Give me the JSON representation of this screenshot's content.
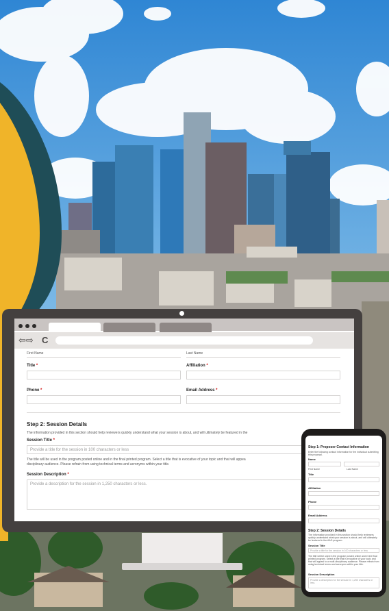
{
  "form": {
    "first_name_label": "First Name",
    "last_name_label": "Last Name",
    "title_label": "Title",
    "affiliation_label": "Affiliation",
    "phone_label": "Phone",
    "email_label": "Email Address",
    "required_marker": "*",
    "step2_heading": "Step 2: Session Details",
    "step2_intro": "The information provided in this section should help reviewers quickly understand what your session is about, and will ultimately be featured in the",
    "session_title_label": "Session Title",
    "session_title_placeholder": "Provide a title for the session in 100 characters or less",
    "session_title_help_1": "The title will be used in the program posted online and in the final printed program. Select a title that is evocative of your topic and that will appea",
    "session_title_help_2": "disciplinary audience. Please refrain from using technical terms and acronyms within your title.",
    "session_description_label": "Session Description",
    "session_description_placeholder": "Provide a description for the session in 1,250 characters or less."
  },
  "browser": {
    "nav_arrows": "⇦⇨",
    "reload": "C"
  },
  "phone": {
    "step1_heading": "Step 1: Proposer Contact Information",
    "step1_intro": "Enter the following contact information for the individual submitting this proposal.",
    "name_label": "Name",
    "first_name_label": "First Name",
    "last_name_label": "Last Name",
    "title_label": "Title",
    "affiliation_label": "Affiliation",
    "phone_label": "Phone",
    "email_label": "Email Address",
    "step2_heading": "Step 2: Session Details",
    "step2_intro": "The information provided in this section should help reviewers quickly understand what your session is about, and will ultimately be featured in the AAG program.",
    "session_title_label": "Session Title",
    "session_title_placeholder": "Provide a title for the session in 100 characters or less",
    "session_title_help": "The title will be used in the program posted online and in the final printed program. Select a title that is evocative of your topic and that will appeal to a multi-disciplinary audience. Please refrain from using technical terms and acronyms within your title.",
    "session_description_label": "Session Description",
    "session_description_placeholder": "Provide a description for the session in 1,250 characters or less."
  },
  "colors": {
    "sky_top": "#3f8fd6",
    "gold": "#f0b429",
    "teal": "#1f4d57",
    "monitor": "#44403f"
  }
}
